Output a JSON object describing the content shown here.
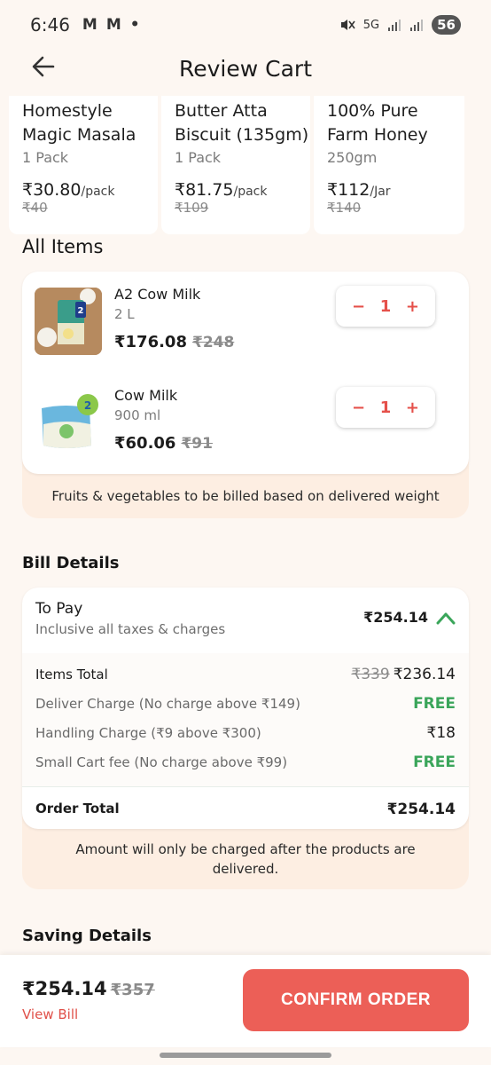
{
  "status_bar": {
    "time": "6:46",
    "notif_icons": [
      "M",
      "M"
    ],
    "network": "5G",
    "battery": "56"
  },
  "header": {
    "title": "Review Cart"
  },
  "suggestions": [
    {
      "name": "Homestyle Magic Masala -...",
      "qty": "1 Pack",
      "price": "₹30.80",
      "unit": "/pack",
      "mrp": "₹40"
    },
    {
      "name": "Butter Atta Biscuit  (135gm)",
      "qty": "1 Pack",
      "price": "₹81.75",
      "unit": "/pack",
      "mrp": "₹109"
    },
    {
      "name": "100% Pure Farm Honey",
      "qty": "250gm",
      "price": "₹112",
      "unit": "/Jar",
      "mrp": "₹140"
    }
  ],
  "all_items": {
    "title": "All Items",
    "items": [
      {
        "name": "A2 Cow Milk",
        "qty": "2 L",
        "price": "₹176.08",
        "mrp": "₹248",
        "count": "1",
        "minus": "−",
        "plus": "+",
        "badge": "2"
      },
      {
        "name": "Cow Milk",
        "qty": "900 ml",
        "price": "₹60.06",
        "mrp": "₹91",
        "count": "1",
        "minus": "−",
        "plus": "+",
        "badge": "2"
      }
    ],
    "note": "Fruits & vegetables to be billed based on delivered weight"
  },
  "bill": {
    "title": "Bill Details",
    "to_pay_label": "To Pay",
    "to_pay_sub": "Inclusive all taxes & charges",
    "to_pay_amount": "₹254.14",
    "lines": [
      {
        "label": "Items Total",
        "mrp": "₹339",
        "value": "₹236.14"
      },
      {
        "label": "Deliver Charge (No charge above ₹149)",
        "value": "FREE"
      },
      {
        "label": "Handling Charge (₹9 above ₹300)",
        "value": "₹18"
      },
      {
        "label": "Small Cart fee (No charge above ₹99)",
        "value": "FREE"
      }
    ],
    "order_total_label": "Order Total",
    "order_total": "₹254.14",
    "note": "Amount will only be charged after the products are delivered."
  },
  "saving": {
    "title": "Saving Details"
  },
  "footer": {
    "total": "₹254.14",
    "mrp": "₹357",
    "view_bill": "View Bill",
    "confirm": "CONFIRM ORDER"
  },
  "colors": {
    "accent": "#ec5f57",
    "free": "#3aa55a",
    "background": "#fdf7f2",
    "panel": "#fdeee2"
  }
}
